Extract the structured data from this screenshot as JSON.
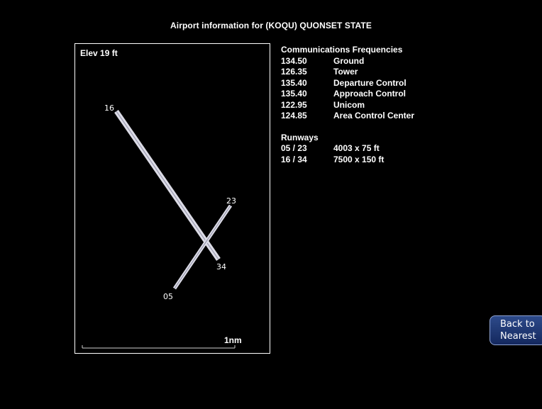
{
  "title": "Airport information for (KOQU) QUONSET STATE",
  "elevation": "Elev  19 ft",
  "scale_label": "1nm",
  "runway_labels": {
    "r16": "16",
    "r34": "34",
    "r05": "05",
    "r23": "23"
  },
  "communications": {
    "header": "Communications Frequencies",
    "items": [
      {
        "freq": "134.50",
        "name": "Ground"
      },
      {
        "freq": "126.35",
        "name": "Tower"
      },
      {
        "freq": "135.40",
        "name": "Departure Control"
      },
      {
        "freq": "135.40",
        "name": "Approach Control"
      },
      {
        "freq": "122.95",
        "name": "Unicom"
      },
      {
        "freq": "124.85",
        "name": "Area Control Center"
      }
    ]
  },
  "runways": {
    "header": "Runways",
    "items": [
      {
        "id": "05 / 23",
        "size": "4003 x 75 ft"
      },
      {
        "id": "16 / 34",
        "size": "7500 x 150 ft"
      }
    ]
  },
  "back_button": {
    "line1": "Back to",
    "line2": "Nearest"
  }
}
